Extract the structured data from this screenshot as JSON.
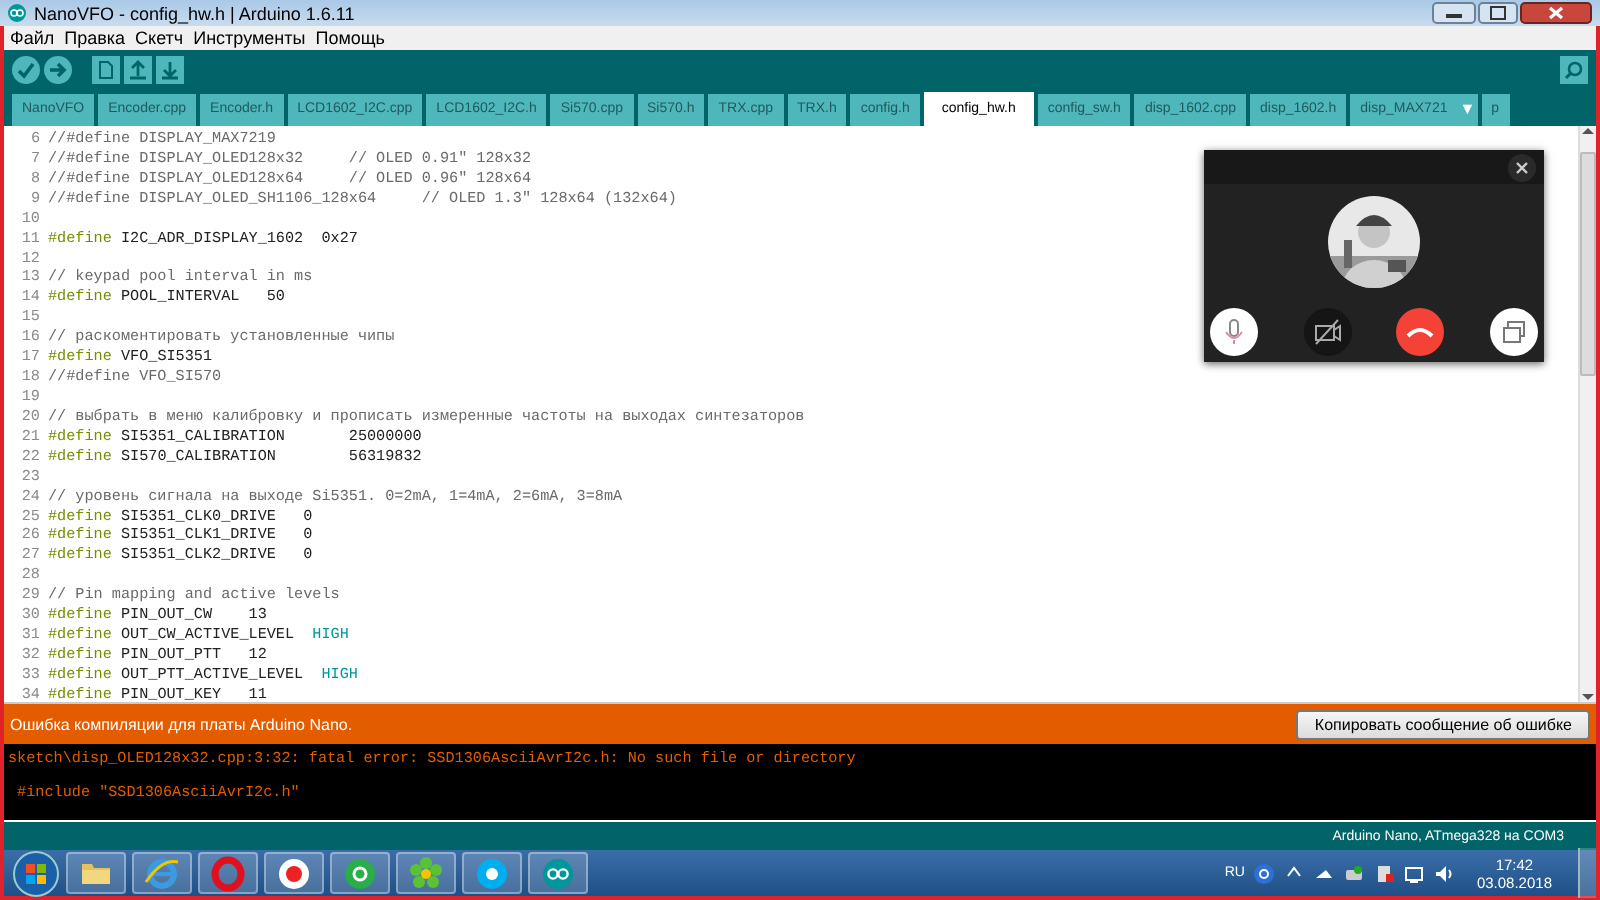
{
  "window": {
    "title": "NanoVFO - config_hw.h | Arduino 1.6.11"
  },
  "menu": [
    "Файл",
    "Правка",
    "Скетч",
    "Инструменты",
    "Помощь"
  ],
  "tabs": [
    {
      "label": "NanoVFO",
      "selected": false
    },
    {
      "label": "Encoder.cpp",
      "selected": false
    },
    {
      "label": "Encoder.h",
      "selected": false
    },
    {
      "label": "LCD1602_I2C.cpp",
      "selected": false
    },
    {
      "label": "LCD1602_I2C.h",
      "selected": false
    },
    {
      "label": "Si570.cpp",
      "selected": false
    },
    {
      "label": "Si570.h",
      "selected": false
    },
    {
      "label": "TRX.cpp",
      "selected": false
    },
    {
      "label": "TRX.h",
      "selected": false
    },
    {
      "label": "config.h",
      "selected": false
    },
    {
      "label": "config_hw.h",
      "selected": true
    },
    {
      "label": "config_sw.h",
      "selected": false
    },
    {
      "label": "disp_1602.cpp",
      "selected": false
    },
    {
      "label": "disp_1602.h",
      "selected": false
    },
    {
      "label": "disp_MAX721",
      "selected": false
    }
  ],
  "tab_menu": "▼",
  "tab_overflow": "p",
  "code": [
    {
      "number": "6",
      "tokens": [
        {
          "kind": "comment",
          "text": "//#define DISPLAY_MAX7219"
        }
      ]
    },
    {
      "number": "7",
      "tokens": [
        {
          "kind": "comment",
          "text": "//#define DISPLAY_OLED128x32     // OLED 0.91\" 128x32"
        }
      ]
    },
    {
      "number": "8",
      "tokens": [
        {
          "kind": "comment",
          "text": "//#define DISPLAY_OLED128x64     // OLED 0.96\" 128x64"
        }
      ]
    },
    {
      "number": "9",
      "tokens": [
        {
          "kind": "comment",
          "text": "//#define DISPLAY_OLED_SH1106_128x64     // OLED 1.3\" 128x64 (132x64)"
        }
      ]
    },
    {
      "number": "10"
    },
    {
      "number": "11",
      "tokens": [
        {
          "kind": "keyword",
          "text": "#define"
        },
        {
          "kind": "plain",
          "text": " I2C_ADR_DISPLAY_1602  0x27"
        }
      ]
    },
    {
      "number": "12"
    },
    {
      "number": "13",
      "tokens": [
        {
          "kind": "comment",
          "text": "// keypad pool interval in ms"
        }
      ]
    },
    {
      "number": "14",
      "tokens": [
        {
          "kind": "keyword",
          "text": "#define"
        },
        {
          "kind": "plain",
          "text": " POOL_INTERVAL   50"
        }
      ]
    },
    {
      "number": "15"
    },
    {
      "number": "16",
      "tokens": [
        {
          "kind": "comment",
          "text": "// раскоментировать установленные чипы"
        }
      ]
    },
    {
      "number": "17",
      "tokens": [
        {
          "kind": "keyword",
          "text": "#define"
        },
        {
          "kind": "plain",
          "text": " VFO_SI5351"
        }
      ]
    },
    {
      "number": "18",
      "tokens": [
        {
          "kind": "comment",
          "text": "//#define VFO_SI570"
        }
      ]
    },
    {
      "number": "19"
    },
    {
      "number": "20",
      "tokens": [
        {
          "kind": "comment",
          "text": "// выбрать в меню калибровку и прописать измеренные частоты на выходах синтезаторов"
        }
      ]
    },
    {
      "number": "21",
      "tokens": [
        {
          "kind": "keyword",
          "text": "#define"
        },
        {
          "kind": "plain",
          "text": " SI5351_CALIBRATION       25000000"
        }
      ]
    },
    {
      "number": "22",
      "tokens": [
        {
          "kind": "keyword",
          "text": "#define"
        },
        {
          "kind": "plain",
          "text": " SI570_CALIBRATION        56319832"
        }
      ]
    },
    {
      "number": "23"
    },
    {
      "number": "24",
      "tokens": [
        {
          "kind": "comment",
          "text": "// уровень сигнала на выходе Si5351. 0=2mA, 1=4mA, 2=6mA, 3=8mA"
        }
      ]
    },
    {
      "number": "25",
      "tokens": [
        {
          "kind": "keyword",
          "text": "#define"
        },
        {
          "kind": "plain",
          "text": " SI5351_CLK0_DRIVE   0"
        }
      ]
    },
    {
      "number": "26",
      "tokens": [
        {
          "kind": "keyword",
          "text": "#define"
        },
        {
          "kind": "plain",
          "text": " SI5351_CLK1_DRIVE   0"
        }
      ]
    },
    {
      "number": "27",
      "tokens": [
        {
          "kind": "keyword",
          "text": "#define"
        },
        {
          "kind": "plain",
          "text": " SI5351_CLK2_DRIVE   0"
        }
      ]
    },
    {
      "number": "28"
    },
    {
      "number": "29",
      "tokens": [
        {
          "kind": "comment",
          "text": "// Pin mapping and active levels"
        }
      ]
    },
    {
      "number": "30",
      "tokens": [
        {
          "kind": "keyword",
          "text": "#define"
        },
        {
          "kind": "plain",
          "text": " PIN_OUT_CW    13"
        }
      ]
    },
    {
      "number": "31",
      "tokens": [
        {
          "kind": "keyword",
          "text": "#define"
        },
        {
          "kind": "plain",
          "text": " OUT_CW_ACTIVE_LEVEL  "
        },
        {
          "kind": "constant",
          "text": "HIGH"
        }
      ]
    },
    {
      "number": "32",
      "tokens": [
        {
          "kind": "keyword",
          "text": "#define"
        },
        {
          "kind": "plain",
          "text": " PIN_OUT_PTT   12"
        }
      ]
    },
    {
      "number": "33",
      "tokens": [
        {
          "kind": "keyword",
          "text": "#define"
        },
        {
          "kind": "plain",
          "text": " OUT_PTT_ACTIVE_LEVEL  "
        },
        {
          "kind": "constant",
          "text": "HIGH"
        }
      ]
    },
    {
      "number": "34",
      "tokens": [
        {
          "kind": "keyword",
          "text": "#define"
        },
        {
          "kind": "plain",
          "text": " PIN_OUT_KEY   11"
        }
      ]
    }
  ],
  "call": {
    "buttons": [
      {
        "kind": "mic"
      },
      {
        "kind": "video_off"
      },
      {
        "kind": "hangup"
      },
      {
        "kind": "window"
      }
    ]
  },
  "error_bar": {
    "message": "Ошибка компиляции для платы Arduino Nano.",
    "button": "Копировать сообщение об ошибке"
  },
  "console": [
    {
      "text": "sketch\\disp_OLED128x32.cpp:3:32: fatal error: SSD1306AsciiAvrI2c.h: No such file or directory"
    },
    {
      "text": " #include \"SSD1306AsciiAvrI2c.h\""
    }
  ],
  "status_bar": "Arduino Nano, ATmega328 на COM3",
  "taskbar": {
    "apps": [
      {
        "kind": "folder"
      },
      {
        "kind": "ie"
      },
      {
        "kind": "opera"
      },
      {
        "kind": "yandex"
      },
      {
        "kind": "mail"
      },
      {
        "kind": "icq"
      },
      {
        "kind": "skype"
      },
      {
        "kind": "arduino"
      }
    ],
    "language": "RU",
    "time": "17:42",
    "date": "03.08.2018"
  }
}
